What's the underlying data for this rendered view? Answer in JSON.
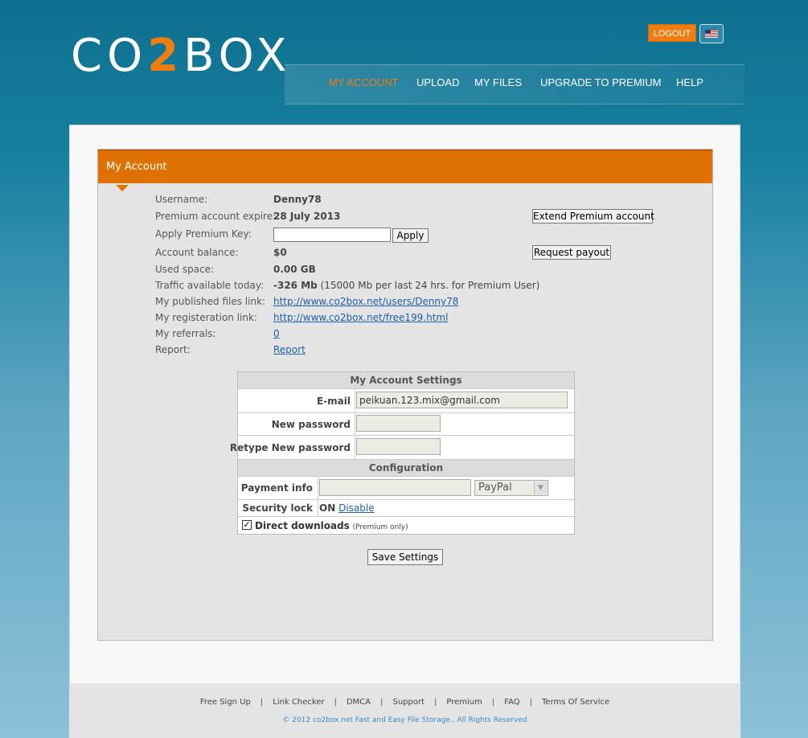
{
  "brand": {
    "logo_part1": "CO",
    "logo_part2": "2",
    "logo_part3": "BOX"
  },
  "header": {
    "logout_label": "LOGOUT",
    "flag_icon": "us-flag-icon"
  },
  "nav": {
    "items": [
      {
        "label": "MY ACCOUNT",
        "active": true
      },
      {
        "label": "UPLOAD"
      },
      {
        "label": "MY FILES"
      },
      {
        "label": "UPGRADE TO PREMIUM"
      },
      {
        "label": "HELP"
      }
    ]
  },
  "account": {
    "title": "My Account",
    "username_label": "Username:",
    "username": "Denny78",
    "premium_expire_label": "Premium account expire:",
    "premium_expire": "28 July 2013",
    "premium_key_label": "Apply Premium Key:",
    "apply_button": "Apply",
    "balance_label": "Account balance:",
    "balance": "$0",
    "used_space_label": "Used space:",
    "used_space": "0.00 GB",
    "traffic_label": "Traffic available today:",
    "traffic_value": "-326 Mb",
    "traffic_note": "(15000 Mb per last 24 hrs. for Premium User)",
    "published_label": "My published files link:",
    "published_link": "http://www.co2box.net/users/Denny78",
    "registration_label": "My registeration link:",
    "registration_link": "http://www.co2box.net/free199.html",
    "referrals_label": "My referrals:",
    "referrals": "0",
    "report_label": "Report:",
    "report_link": "Report",
    "extend_button": "Extend Premium account",
    "payout_button": "Request payout"
  },
  "settings": {
    "header": "My Account Settings",
    "email_label": "E-mail",
    "email_value": "peikuan.123.mix@gmail.com",
    "new_password_label": "New password",
    "retype_password_label": "Retype New password",
    "config_header": "Configuration",
    "payment_label": "Payment info",
    "payment_method": "PayPal",
    "security_lock_label": "Security lock",
    "security_lock_state": "ON",
    "security_lock_action": "Disable",
    "direct_downloads_label": "Direct downloads",
    "direct_downloads_note": "(Premium only)",
    "direct_downloads_checked": true,
    "save_button": "Save Settings"
  },
  "footer": {
    "links": [
      "Free Sign Up",
      "Link Checker",
      "DMCA",
      "Support",
      "Premium",
      "FAQ",
      "Terms Of Service"
    ],
    "copyright": "© 2012 co2box.net Fast and Easy File Storage., All Rights Reserved"
  }
}
